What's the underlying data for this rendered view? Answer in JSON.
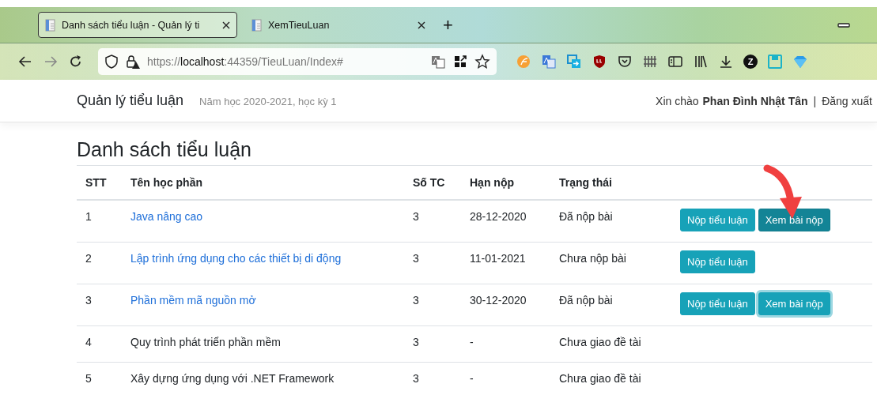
{
  "browser": {
    "tabs": [
      {
        "title": "Danh sách tiểu luận - Quản lý ti",
        "selected": true
      },
      {
        "title": "XemTieuLuan",
        "selected": false
      }
    ],
    "new_tab": "+",
    "address": {
      "scheme": "https://",
      "host": "localhost",
      "rest": ":44359/TieuLuan/Index#"
    },
    "profile_badge": "Z"
  },
  "navbar": {
    "brand": "Quản lý tiểu luận",
    "term": "Năm học 2020-2021, học kỳ 1",
    "greeting": "Xin chào",
    "user": "Phan Đình Nhật Tân",
    "separator": "|",
    "logout": "Đăng xuất"
  },
  "page": {
    "heading": "Danh sách tiểu luận"
  },
  "table": {
    "columns": [
      "STT",
      "Tên học phần",
      "Số TC",
      "Hạn nộp",
      "Trạng thái"
    ],
    "rows": [
      {
        "no": "1",
        "course": "Java nâng cao",
        "link": true,
        "credits": "3",
        "due": "28-12-2020",
        "status": "Đã nộp bài",
        "buttons": [
          {
            "label": "Nộp tiểu luận",
            "hovered": false,
            "focused": false
          },
          {
            "label": "Xem bài nộp",
            "hovered": true,
            "focused": false
          }
        ]
      },
      {
        "no": "2",
        "course": "Lập trình ứng dụng cho các thiết bị di động",
        "link": true,
        "credits": "3",
        "due": "11-01-2021",
        "status": "Chưa nộp bài",
        "buttons": [
          {
            "label": "Nộp tiểu luận",
            "hovered": false,
            "focused": false
          }
        ]
      },
      {
        "no": "3",
        "course": "Phần mềm mã nguồn mở",
        "link": true,
        "credits": "3",
        "due": "30-12-2020",
        "status": "Đã nộp bài",
        "buttons": [
          {
            "label": "Nộp tiểu luận",
            "hovered": false,
            "focused": false
          },
          {
            "label": "Xem bài nộp",
            "hovered": false,
            "focused": true
          }
        ]
      },
      {
        "no": "4",
        "course": "Quy trình phát triển phần mềm",
        "link": false,
        "credits": "3",
        "due": "-",
        "status": "Chưa giao đề tài"
      },
      {
        "no": "5",
        "course": "Xây dựng ứng dụng với .NET Framework",
        "link": false,
        "credits": "3",
        "due": "-",
        "status": "Chưa giao đề tài"
      }
    ]
  }
}
